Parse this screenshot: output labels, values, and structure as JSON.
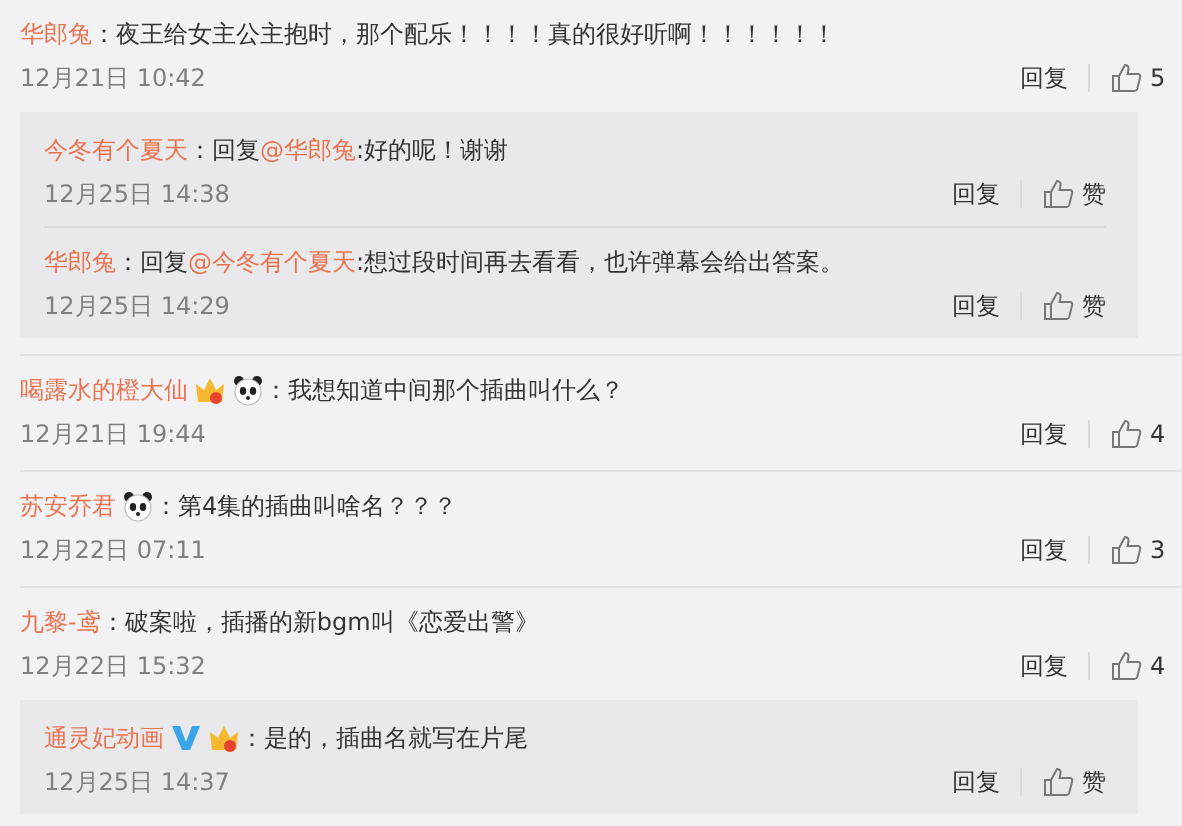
{
  "comments": [
    {
      "name": "华郎兔",
      "text": "：夜王给女主公主抱时，那个配乐！！！！真的很好听啊！！！！！！",
      "time": "12月21日 10:42",
      "reply_label": "回复",
      "likes": "5",
      "replies": [
        {
          "name": "今冬有个夏天",
          "prefix": "：回复",
          "mention": "@华郎兔",
          "text": ":好的呢！谢谢",
          "time": "12月25日 14:38",
          "reply_label": "回复",
          "likes": "赞"
        },
        {
          "name": "华郎兔",
          "prefix": "：回复",
          "mention": "@今冬有个夏天",
          "text": ":想过段时间再去看看，也许弹幕会给出答案。",
          "time": "12月25日 14:29",
          "reply_label": "回复",
          "likes": "赞"
        }
      ]
    },
    {
      "name": "喝露水的橙大仙",
      "badges": [
        {
          "kind": "crown"
        },
        {
          "kind": "panda"
        }
      ],
      "text": "：我想知道中间那个插曲叫什么？",
      "time": "12月21日 19:44",
      "reply_label": "回复",
      "likes": "4"
    },
    {
      "name": "苏安乔君",
      "badges": [
        {
          "kind": "panda"
        }
      ],
      "text": "：第4集的插曲叫啥名？？？",
      "time": "12月22日 07:11",
      "reply_label": "回复",
      "likes": "3"
    },
    {
      "name": "九黎-鸢",
      "text": "：破案啦，插播的新bgm叫《恋爱出警》",
      "time": "12月22日 15:32",
      "reply_label": "回复",
      "likes": "4",
      "replies": [
        {
          "name": "通灵妃动画",
          "badges": [
            {
              "kind": "verified"
            },
            {
              "kind": "crown"
            }
          ],
          "text": "：是的，插曲名就写在片尾",
          "time": "12月25日 14:37",
          "reply_label": "回复",
          "likes": "赞"
        }
      ]
    }
  ]
}
